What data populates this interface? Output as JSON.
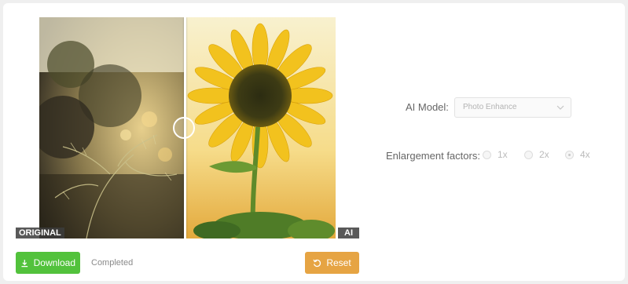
{
  "compare": {
    "original_tag": "ORIGINAL",
    "ai_tag": "AI"
  },
  "actions": {
    "download_label": "Download",
    "status_text": "Completed",
    "reset_label": "Reset"
  },
  "settings": {
    "model_label": "AI Model:",
    "model_value": "Photo Enhance",
    "factor_label": "Enlargement factors:",
    "factors": [
      {
        "label": "1x",
        "selected": false
      },
      {
        "label": "2x",
        "selected": false
      },
      {
        "label": "4x",
        "selected": true
      }
    ]
  },
  "colors": {
    "download": "#52c23c",
    "reset": "#e6a443"
  }
}
